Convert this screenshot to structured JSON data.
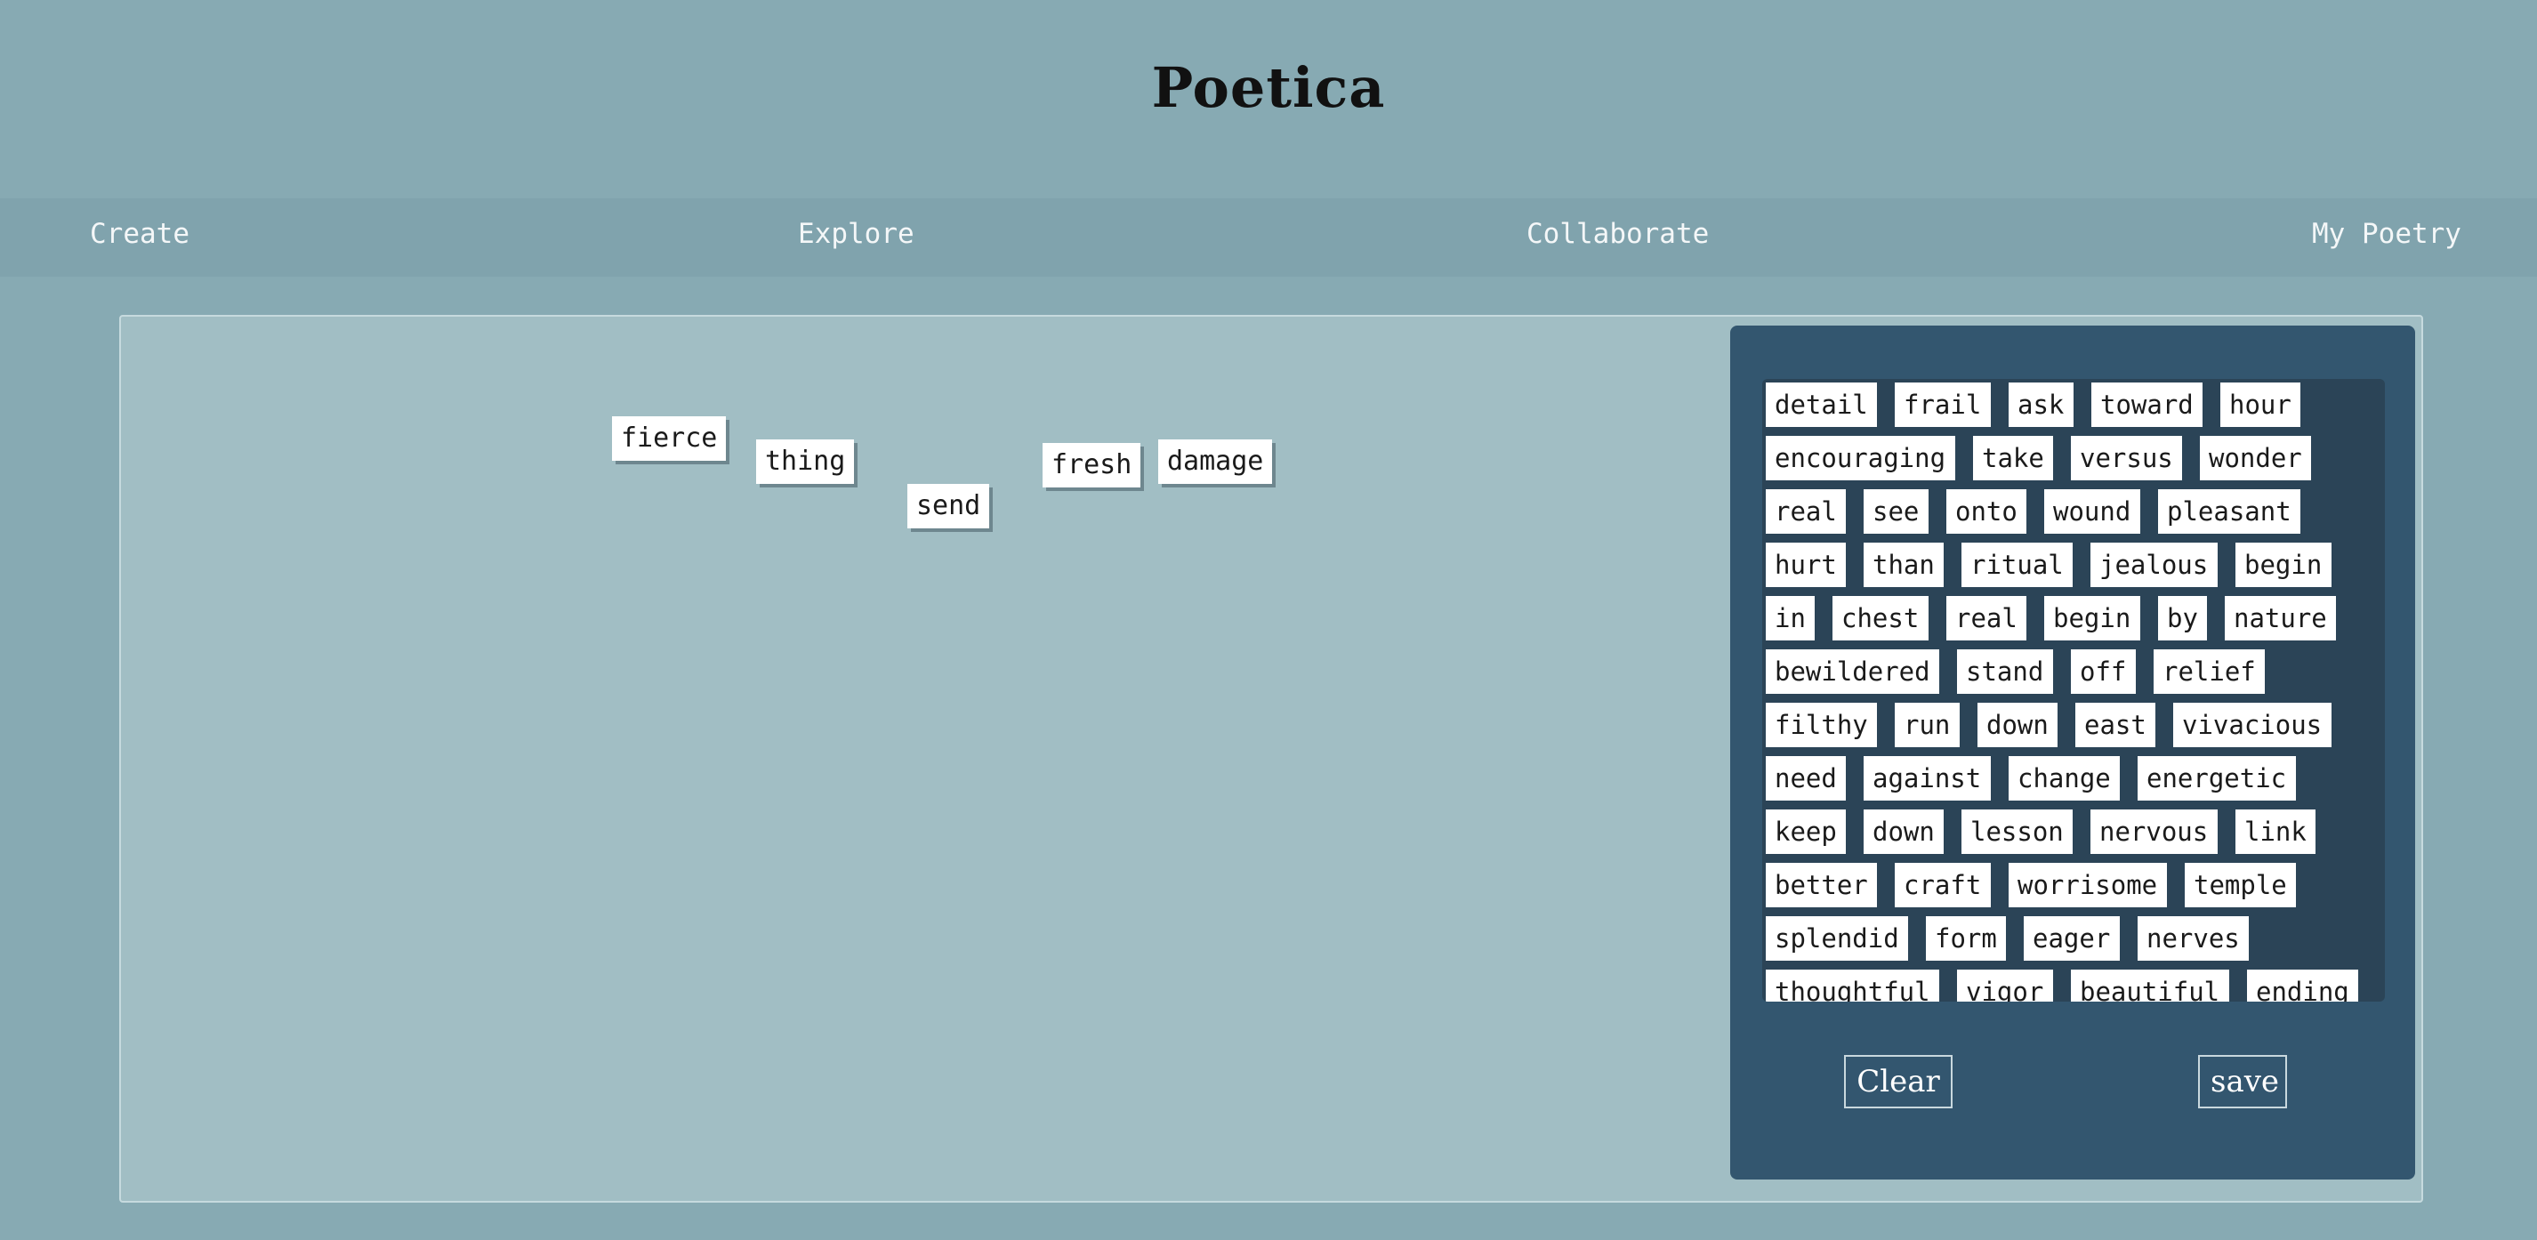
{
  "app": {
    "title": "Poetica"
  },
  "nav": {
    "items": [
      {
        "label": "Create"
      },
      {
        "label": "Explore"
      },
      {
        "label": "Collaborate"
      },
      {
        "label": "My Poetry"
      }
    ]
  },
  "canvas": {
    "placed_words": [
      {
        "word": "fierce"
      },
      {
        "word": "thing"
      },
      {
        "word": "send"
      },
      {
        "word": "fresh"
      },
      {
        "word": "damage"
      }
    ]
  },
  "word_bank": {
    "words": [
      "detail",
      "frail",
      "ask",
      "toward",
      "hour",
      "encouraging",
      "take",
      "versus",
      "wonder",
      "real",
      "see",
      "onto",
      "wound",
      "pleasant",
      "hurt",
      "than",
      "ritual",
      "jealous",
      "begin",
      "in",
      "chest",
      "real",
      "begin",
      "by",
      "nature",
      "bewildered",
      "stand",
      "off",
      "relief",
      "filthy",
      "run",
      "down",
      "east",
      "vivacious",
      "need",
      "against",
      "change",
      "energetic",
      "keep",
      "down",
      "lesson",
      "nervous",
      "link",
      "better",
      "craft",
      "worrisome",
      "temple",
      "splendid",
      "form",
      "eager",
      "nerves",
      "thoughtful",
      "vigor",
      "beautiful",
      "ending"
    ]
  },
  "controls": {
    "clear_label": "Clear",
    "save_label": "save"
  },
  "colors": {
    "background": "#87aab3",
    "nav_bar": "#80a3ad",
    "canvas": "#a1bec4",
    "panel": "#33566f",
    "word_bank": "#2b4457",
    "tile": "#ffffff"
  }
}
